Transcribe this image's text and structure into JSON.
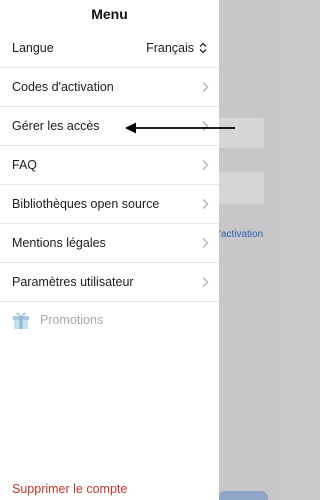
{
  "menu": {
    "title": "Menu",
    "language": {
      "label": "Langue",
      "value": "Français"
    },
    "items": [
      {
        "label": "Codes d'activation"
      },
      {
        "label": "Gérer les accès"
      },
      {
        "label": "FAQ"
      },
      {
        "label": "Bibliothèques open source"
      },
      {
        "label": "Mentions légales"
      },
      {
        "label": "Paramètres utilisateur"
      }
    ],
    "promotions": {
      "label": "Promotions",
      "icon": "gift-icon"
    },
    "delete_account": "Supprimer le compte"
  },
  "background": {
    "link_text": "'activation"
  },
  "colors": {
    "delete": "#c0362c",
    "link": "#2f5fa8",
    "promo_icon": "#9fc3d8"
  }
}
